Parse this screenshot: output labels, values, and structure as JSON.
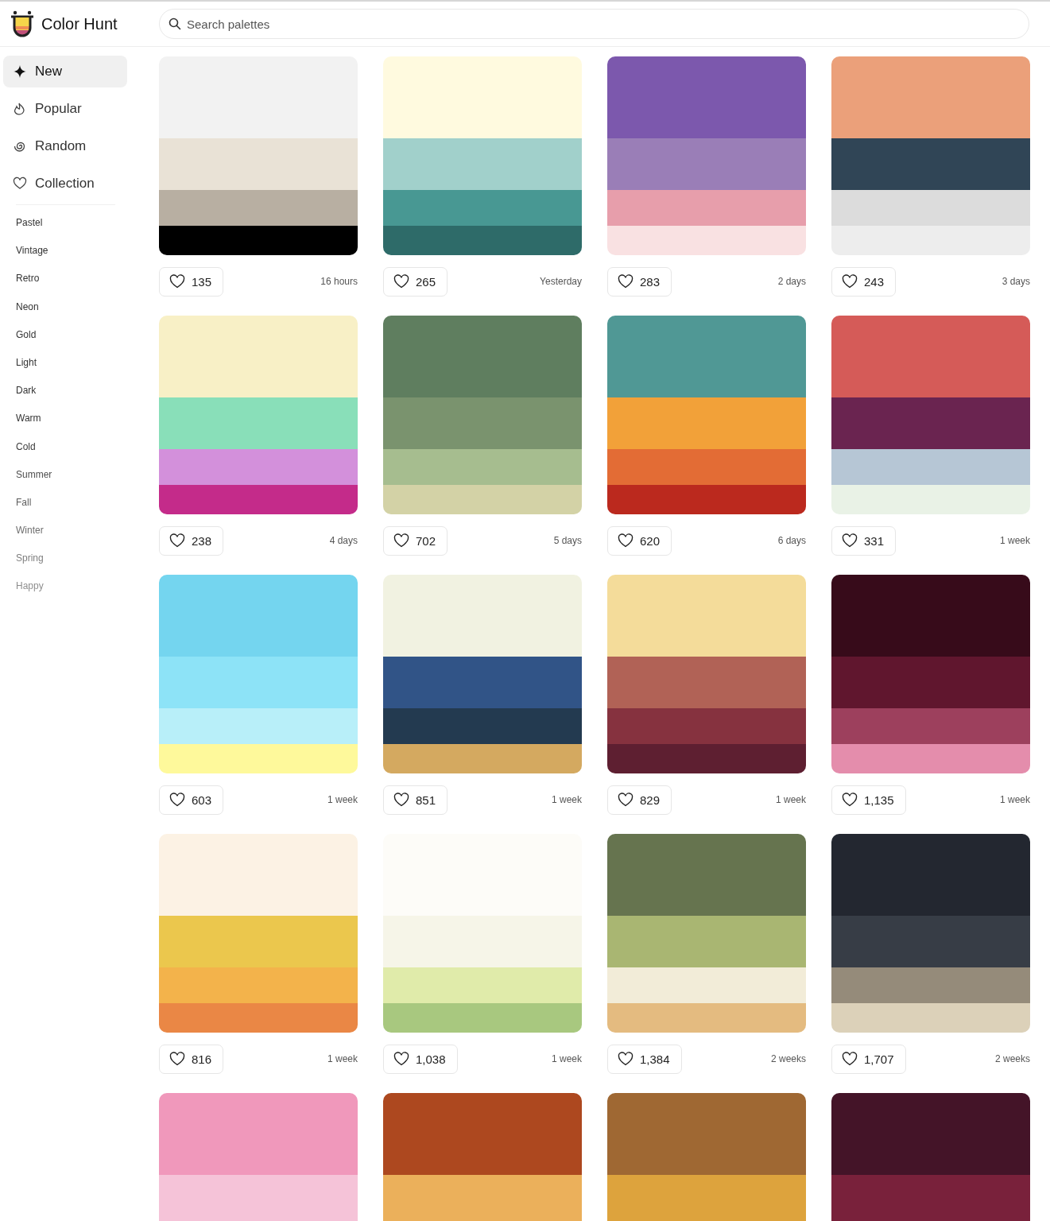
{
  "brand": {
    "name": "Color Hunt"
  },
  "search": {
    "placeholder": "Search palettes"
  },
  "nav": [
    {
      "label": "New",
      "selected": true
    },
    {
      "label": "Popular",
      "selected": false
    },
    {
      "label": "Random",
      "selected": false
    },
    {
      "label": "Collection",
      "selected": false
    }
  ],
  "tags": [
    "Pastel",
    "Vintage",
    "Retro",
    "Neon",
    "Gold",
    "Light",
    "Dark",
    "Warm",
    "Cold",
    "Summer",
    "Fall",
    "Winter",
    "Spring",
    "Happy"
  ],
  "palettes": [
    {
      "swatches": [
        {
          "color": "#f2f2f2"
        },
        {
          "color": "#e9e2d6"
        },
        {
          "color": "#b8afa2"
        },
        {
          "color": "#000000"
        }
      ],
      "likes": "135",
      "age": "16 hours"
    },
    {
      "swatches": [
        {
          "color": "#fffadf"
        },
        {
          "color": "#a1d0cb"
        },
        {
          "color": "#489893"
        },
        {
          "color": "#2e6b69"
        }
      ],
      "likes": "265",
      "age": "Yesterday"
    },
    {
      "swatches": [
        {
          "color": "#7c58ad"
        },
        {
          "color": "#9a7eb7"
        },
        {
          "color": "#e79eab"
        },
        {
          "color": "#f9e1e2"
        }
      ],
      "likes": "283",
      "age": "2 days"
    },
    {
      "swatches": [
        {
          "color": "#eba07a"
        },
        {
          "color": "#304556"
        },
        {
          "color": "#dcdcdc"
        },
        {
          "color": "#ededed"
        }
      ],
      "likes": "243",
      "age": "3 days"
    },
    {
      "swatches": [
        {
          "color": "#f8f0c6"
        },
        {
          "color": "#89dfb9"
        },
        {
          "color": "#d390db"
        },
        {
          "color": "#c42b8a"
        }
      ],
      "likes": "238",
      "age": "4 days"
    },
    {
      "swatches": [
        {
          "color": "#5f7e5f"
        },
        {
          "color": "#7a936e"
        },
        {
          "color": "#a6bd8f"
        },
        {
          "color": "#d3d2a6"
        }
      ],
      "likes": "702",
      "age": "5 days"
    },
    {
      "swatches": [
        {
          "color": "#509895"
        },
        {
          "color": "#f2a139"
        },
        {
          "color": "#e36c35"
        },
        {
          "color": "#bb291e"
        }
      ],
      "likes": "620",
      "age": "6 days"
    },
    {
      "swatches": [
        {
          "color": "#d55b58"
        },
        {
          "color": "#6a2450"
        },
        {
          "color": "#b6c6d5"
        },
        {
          "color": "#e9f2e6"
        }
      ],
      "likes": "331",
      "age": "1 week"
    },
    {
      "swatches": [
        {
          "color": "#74d5ef"
        },
        {
          "color": "#8de3f7"
        },
        {
          "color": "#b8eff9"
        },
        {
          "color": "#fef99b"
        }
      ],
      "likes": "603",
      "age": "1 week"
    },
    {
      "swatches": [
        {
          "color": "#f1f2e1"
        },
        {
          "color": "#315487"
        },
        {
          "color": "#233a50"
        },
        {
          "color": "#d4a960"
        }
      ],
      "likes": "851",
      "age": "1 week"
    },
    {
      "swatches": [
        {
          "color": "#f4dc9a"
        },
        {
          "color": "#b16256"
        },
        {
          "color": "#86323f"
        },
        {
          "color": "#5e1f31"
        }
      ],
      "likes": "829",
      "age": "1 week"
    },
    {
      "swatches": [
        {
          "color": "#370b1a"
        },
        {
          "color": "#60162e"
        },
        {
          "color": "#9d405d"
        },
        {
          "color": "#e48dac"
        }
      ],
      "likes": "1,135",
      "age": "1 week"
    },
    {
      "swatches": [
        {
          "color": "#fcf2e4"
        },
        {
          "color": "#ebc74d"
        },
        {
          "color": "#f3b34b"
        },
        {
          "color": "#ea8745"
        }
      ],
      "likes": "816",
      "age": "1 week"
    },
    {
      "swatches": [
        {
          "color": "#fdfcf8"
        },
        {
          "color": "#f6f5e8"
        },
        {
          "color": "#e0ebaa"
        },
        {
          "color": "#a8c87f"
        }
      ],
      "likes": "1,038",
      "age": "1 week"
    },
    {
      "swatches": [
        {
          "color": "#66744f"
        },
        {
          "color": "#a9b672"
        },
        {
          "color": "#f2ecd8"
        },
        {
          "color": "#e4bb80"
        }
      ],
      "likes": "1,384",
      "age": "2 weeks"
    },
    {
      "swatches": [
        {
          "color": "#232730"
        },
        {
          "color": "#373d46"
        },
        {
          "color": "#958b7a"
        },
        {
          "color": "#dcd1b9"
        }
      ],
      "likes": "1,707",
      "age": "2 weeks"
    },
    {
      "swatches": [
        {
          "color": "#f098bb"
        },
        {
          "color": "#f5c3d8"
        }
      ]
    },
    {
      "swatches": [
        {
          "color": "#ad481f"
        },
        {
          "color": "#ebb05b"
        }
      ]
    },
    {
      "swatches": [
        {
          "color": "#9f6833"
        },
        {
          "color": "#dda33d"
        }
      ]
    },
    {
      "swatches": [
        {
          "color": "#441428"
        },
        {
          "color": "#79213b"
        }
      ]
    }
  ]
}
